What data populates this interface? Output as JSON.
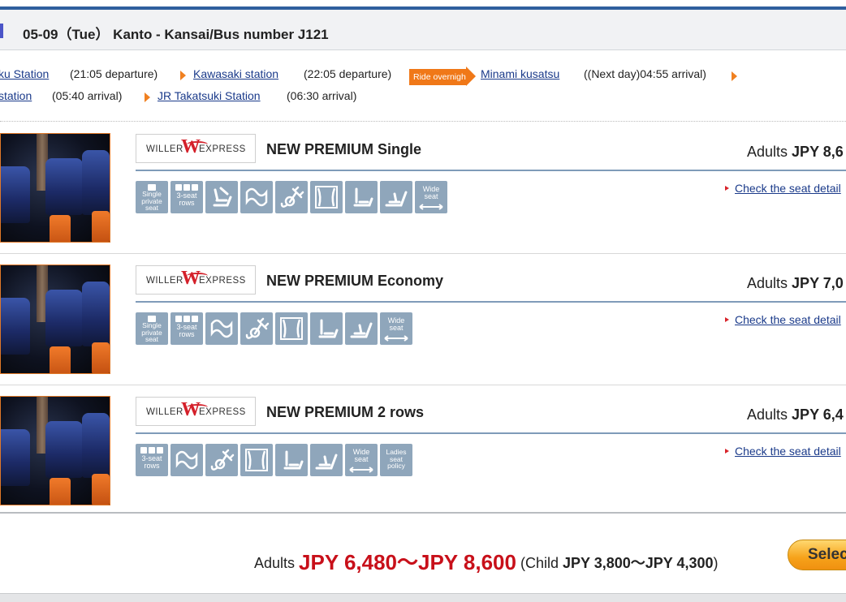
{
  "header": {
    "title": "05-09（Tue） Kanto - Kansai/Bus number J121"
  },
  "route": {
    "row1": [
      {
        "kind": "link",
        "text": "ku Station"
      },
      {
        "kind": "text",
        "text": "(21:05 departure)"
      },
      {
        "kind": "link",
        "text": "Kawasaki station"
      },
      {
        "kind": "text",
        "text": "(22:05 departure)"
      },
      {
        "kind": "badge",
        "text": "Ride overnight"
      },
      {
        "kind": "link",
        "text": "Minami kusatsu"
      },
      {
        "kind": "text",
        "text": "((Next day)04:55 arrival)"
      }
    ],
    "row2": [
      {
        "kind": "link",
        "text": "station"
      },
      {
        "kind": "text",
        "text": "(05:40 arrival)"
      },
      {
        "kind": "link",
        "text": "JR Takatsuki Station"
      },
      {
        "kind": "text",
        "text": "(06:30 arrival)"
      }
    ]
  },
  "brand": {
    "willer": "WILLER",
    "w": "W",
    "express": "EXPRESS"
  },
  "plans": [
    {
      "name": "NEW PREMIUM Single",
      "price_label": "Adults",
      "price_value": "JPY 8,6",
      "detail_link": "Check the seat detail",
      "icons": [
        {
          "name": "single-private-seat-icon",
          "text": "Single private seat"
        },
        {
          "name": "3-seat-rows-icon",
          "text": "3-seat rows"
        },
        {
          "name": "reclining-seat-icon",
          "text": ""
        },
        {
          "name": "blanket-icon",
          "text": ""
        },
        {
          "name": "power-outlet-icon",
          "text": ""
        },
        {
          "name": "curtain-icon",
          "text": ""
        },
        {
          "name": "leg-rest-icon",
          "text": ""
        },
        {
          "name": "foot-rest-icon",
          "text": ""
        },
        {
          "name": "wide-seat-icon",
          "text": "Wide seat"
        }
      ]
    },
    {
      "name": "NEW PREMIUM Economy",
      "price_label": "Adults",
      "price_value": "JPY 7,0",
      "detail_link": "Check the seat detail",
      "icons": [
        {
          "name": "single-private-seat-icon",
          "text": "Single private seat"
        },
        {
          "name": "3-seat-rows-icon",
          "text": "3-seat rows"
        },
        {
          "name": "blanket-icon",
          "text": ""
        },
        {
          "name": "power-outlet-icon",
          "text": ""
        },
        {
          "name": "curtain-icon",
          "text": ""
        },
        {
          "name": "leg-rest-icon",
          "text": ""
        },
        {
          "name": "foot-rest-icon",
          "text": ""
        },
        {
          "name": "wide-seat-icon",
          "text": "Wide seat"
        }
      ]
    },
    {
      "name": "NEW PREMIUM 2 rows",
      "price_label": "Adults",
      "price_value": "JPY 6,4",
      "detail_link": "Check the seat detail",
      "icons": [
        {
          "name": "3-seat-rows-icon",
          "text": "3-seat rows"
        },
        {
          "name": "blanket-icon",
          "text": ""
        },
        {
          "name": "power-outlet-icon",
          "text": ""
        },
        {
          "name": "curtain-icon",
          "text": ""
        },
        {
          "name": "leg-rest-icon",
          "text": ""
        },
        {
          "name": "foot-rest-icon",
          "text": ""
        },
        {
          "name": "wide-seat-icon",
          "text": "Wide seat"
        },
        {
          "name": "ladies-seat-policy-icon",
          "text": "Ladies seat policy"
        }
      ]
    }
  ],
  "footer": {
    "adults_label": "Adults",
    "price_range": "JPY 6,480～JPY 8,600",
    "child_open": "(Child",
    "child_range": "JPY 3,800～JPY 4,300",
    "child_close": ")",
    "select_label": "Select"
  },
  "colors": {
    "accent_orange": "#f07818",
    "price_red": "#c8101a",
    "icon_blue": "#8fa6bb",
    "link_blue": "#1a3a8a"
  }
}
